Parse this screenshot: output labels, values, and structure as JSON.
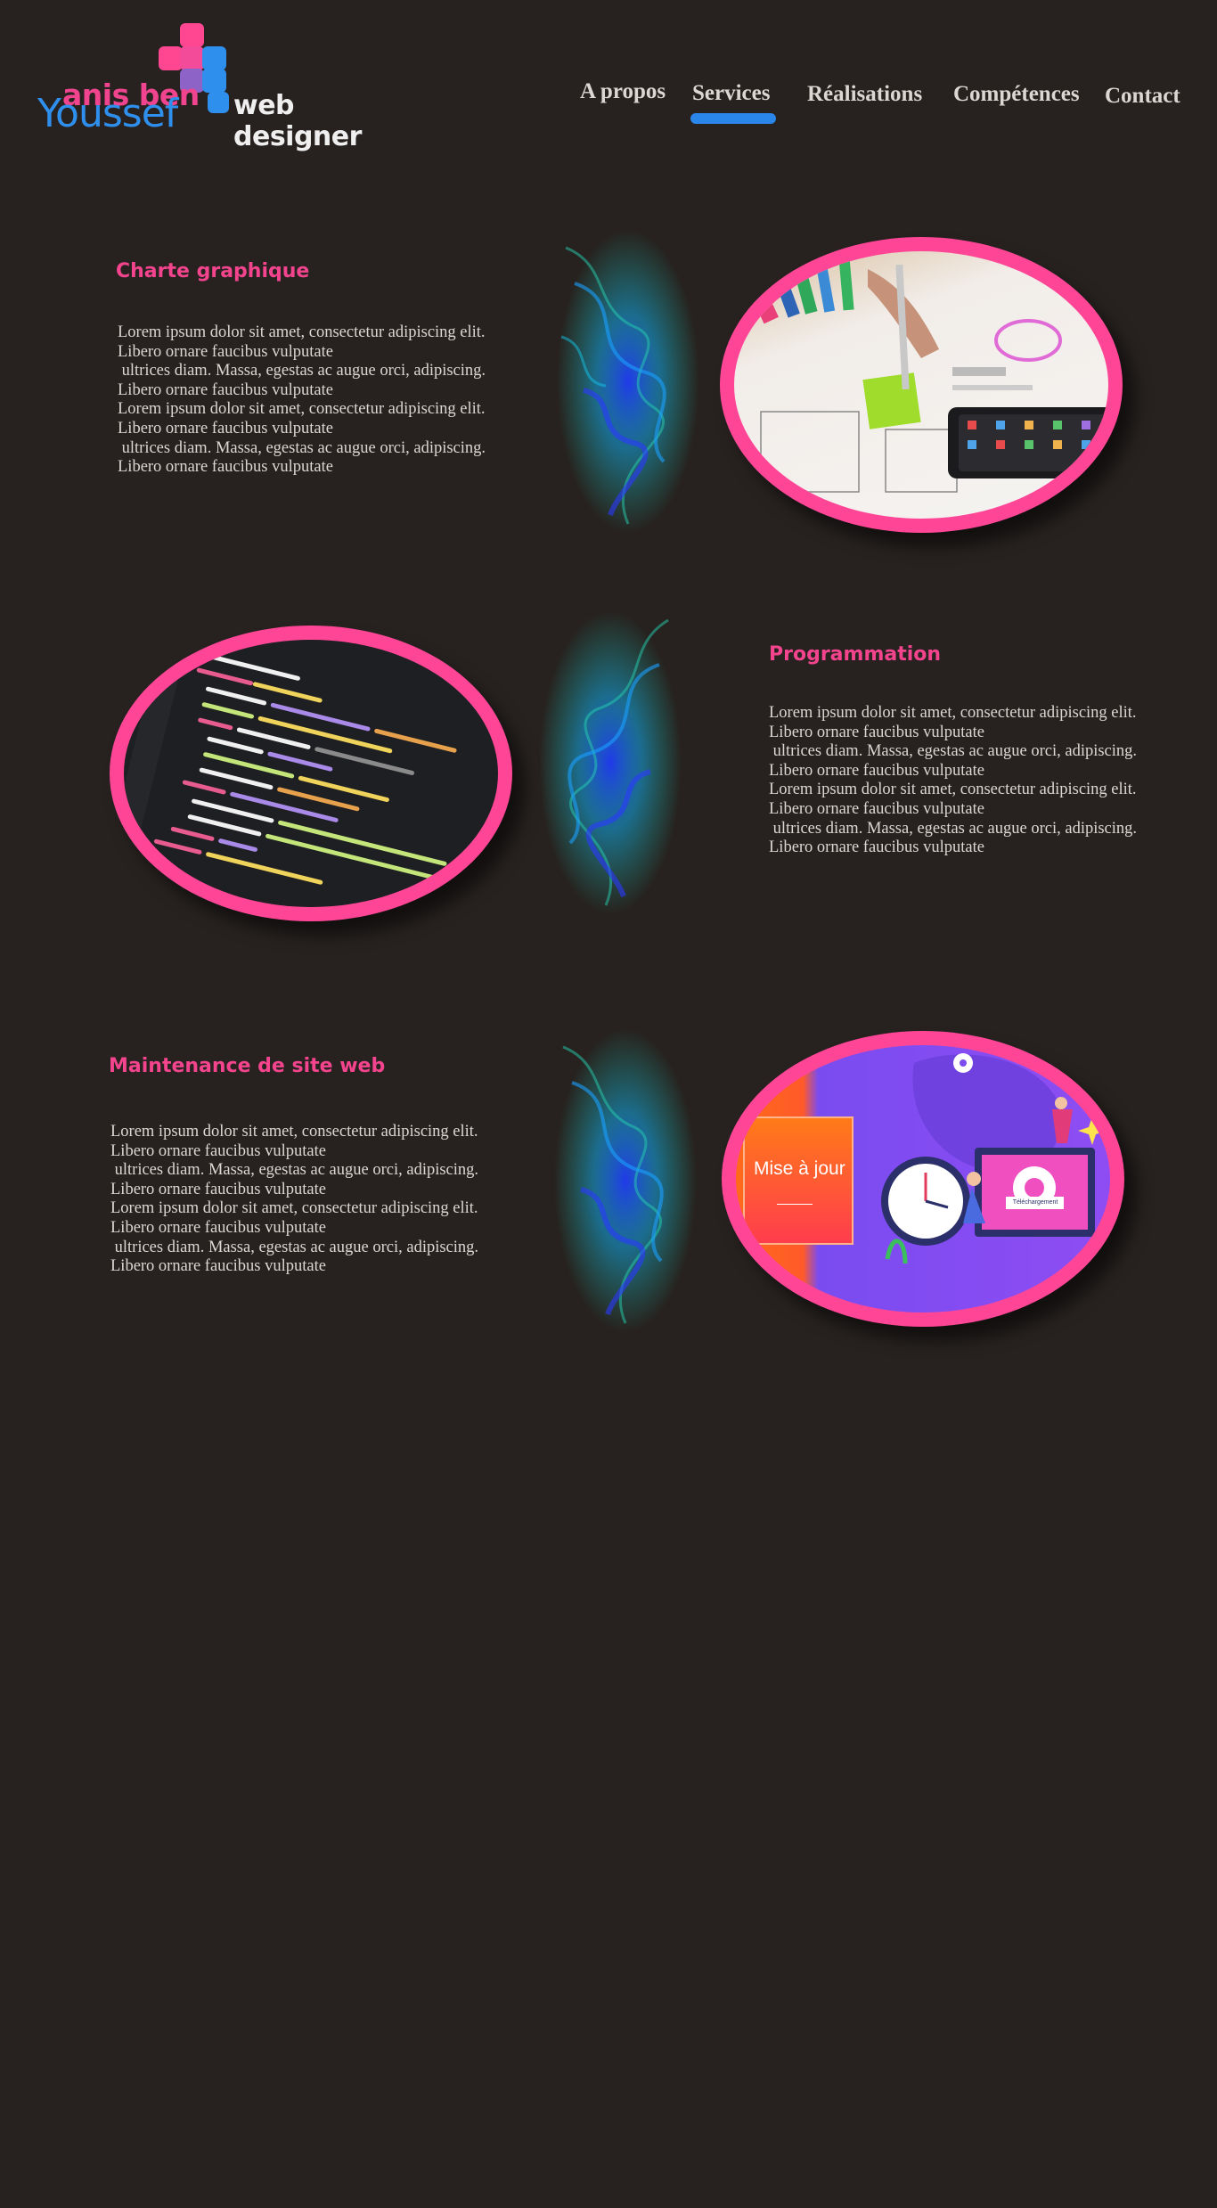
{
  "header": {
    "logo": {
      "name_line1": "anis ben",
      "name_line2": "Youssef",
      "tagline": "web designer"
    },
    "nav": [
      {
        "label": "A propos",
        "active": false
      },
      {
        "label": "Services",
        "active": true
      },
      {
        "label": "Réalisations",
        "active": false
      },
      {
        "label": "Compétences",
        "active": false
      },
      {
        "label": "Contact",
        "active": false
      }
    ]
  },
  "colors": {
    "background": "#272220",
    "accent_pink": "#f3448d",
    "accent_blue": "#2a86e8",
    "text": "#ddd7d3"
  },
  "sections": [
    {
      "title": "Charte graphique",
      "image": "hand-drawing-wireframe-photo",
      "text": "Lorem ipsum dolor sit amet, consectetur adipiscing elit.\nLibero ornare faucibus vulputate\n ultrices diam. Massa, egestas ac augue orci, adipiscing.\nLibero ornare faucibus vulputate\nLorem ipsum dolor sit amet, consectetur adipiscing elit.\nLibero ornare faucibus vulputate\n ultrices diam. Massa, egestas ac augue orci, adipiscing.\nLibero ornare faucibus vulputate"
    },
    {
      "title": "Programmation",
      "image": "code-editor-photo",
      "text": "Lorem ipsum dolor sit amet, consectetur adipiscing elit.\nLibero ornare faucibus vulputate\n ultrices diam. Massa, egestas ac augue orci, adipiscing.\nLibero ornare faucibus vulputate\nLorem ipsum dolor sit amet, consectetur adipiscing elit.\nLibero ornare faucibus vulputate\n ultrices diam. Massa, egestas ac augue orci, adipiscing.\nLibero ornare faucibus vulputate"
    },
    {
      "title": "Maintenance de site web",
      "image": "mise-a-jour-illustration",
      "image_text": "Mise à jour",
      "image_badge": "Téléchargement",
      "text": "Lorem ipsum dolor sit amet, consectetur adipiscing elit.\nLibero ornare faucibus vulputate\n ultrices diam. Massa, egestas ac augue orci, adipiscing.\nLibero ornare faucibus vulputate\nLorem ipsum dolor sit amet, consectetur adipiscing elit.\nLibero ornare faucibus vulputate\n ultrices diam. Massa, egestas ac augue orci, adipiscing.\nLibero ornare faucibus vulputate"
    }
  ]
}
